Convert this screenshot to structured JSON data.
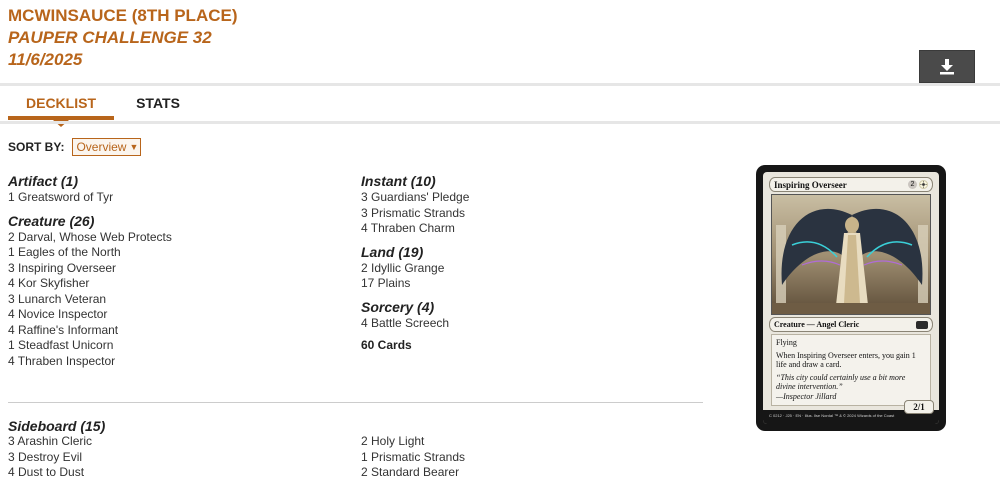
{
  "header": {
    "player_line": "MCWINSAUCE (8TH PLACE)",
    "event_line": "PAUPER CHALLENGE 32",
    "date_line": "11/6/2025"
  },
  "download": {
    "icon": "download-icon"
  },
  "tabs": [
    {
      "label": "DECKLIST",
      "active": true
    },
    {
      "label": "STATS",
      "active": false
    }
  ],
  "sort": {
    "label": "SORT BY:",
    "value": "Overview"
  },
  "groups_left": [
    {
      "title": "Artifact (1)",
      "cards": [
        "1 Greatsword of Tyr"
      ]
    },
    {
      "title": "Creature (26)",
      "cards": [
        "2 Darval, Whose Web Protects",
        "1 Eagles of the North",
        "3 Inspiring Overseer",
        "4 Kor Skyfisher",
        "3 Lunarch Veteran",
        "4 Novice Inspector",
        "4 Raffine's Informant",
        "1 Steadfast Unicorn",
        "4 Thraben Inspector"
      ]
    }
  ],
  "groups_right": [
    {
      "title": "Instant (10)",
      "cards": [
        "3 Guardians' Pledge",
        "3 Prismatic Strands",
        "4 Thraben Charm"
      ]
    },
    {
      "title": "Land (19)",
      "cards": [
        "2 Idyllic Grange",
        "17 Plains"
      ]
    },
    {
      "title": "Sorcery (4)",
      "cards": [
        "4 Battle Screech"
      ]
    }
  ],
  "total": "60 Cards",
  "sideboard": {
    "title": "Sideboard (15)",
    "left": [
      "3 Arashin Cleric",
      "3 Destroy Evil",
      "4 Dust to Dust"
    ],
    "right": [
      "2 Holy Light",
      "1 Prismatic Strands",
      "2 Standard Bearer"
    ]
  },
  "card_preview": {
    "name": "Inspiring Overseer",
    "mana": [
      "2",
      "W"
    ],
    "type_line": "Creature — Angel Cleric",
    "ability_1": "Flying",
    "ability_2": "When Inspiring Overseer enters, you gain 1 life and draw a card.",
    "flavor": "“This city could certainly use a bit more divine intervention.”",
    "flavor_attr": "—Inspector Jillard",
    "pt": "2/1",
    "footer": "C 0212 · J25 · EN · Illus. Ilse Nordal   ™ & © 2024 Wizards of the Coast",
    "colors": {
      "frame": "#e9e6dd",
      "border": "#161616"
    }
  },
  "colors": {
    "accent": "#b8651b",
    "button": "#4a4a4a",
    "text": "#333333"
  }
}
